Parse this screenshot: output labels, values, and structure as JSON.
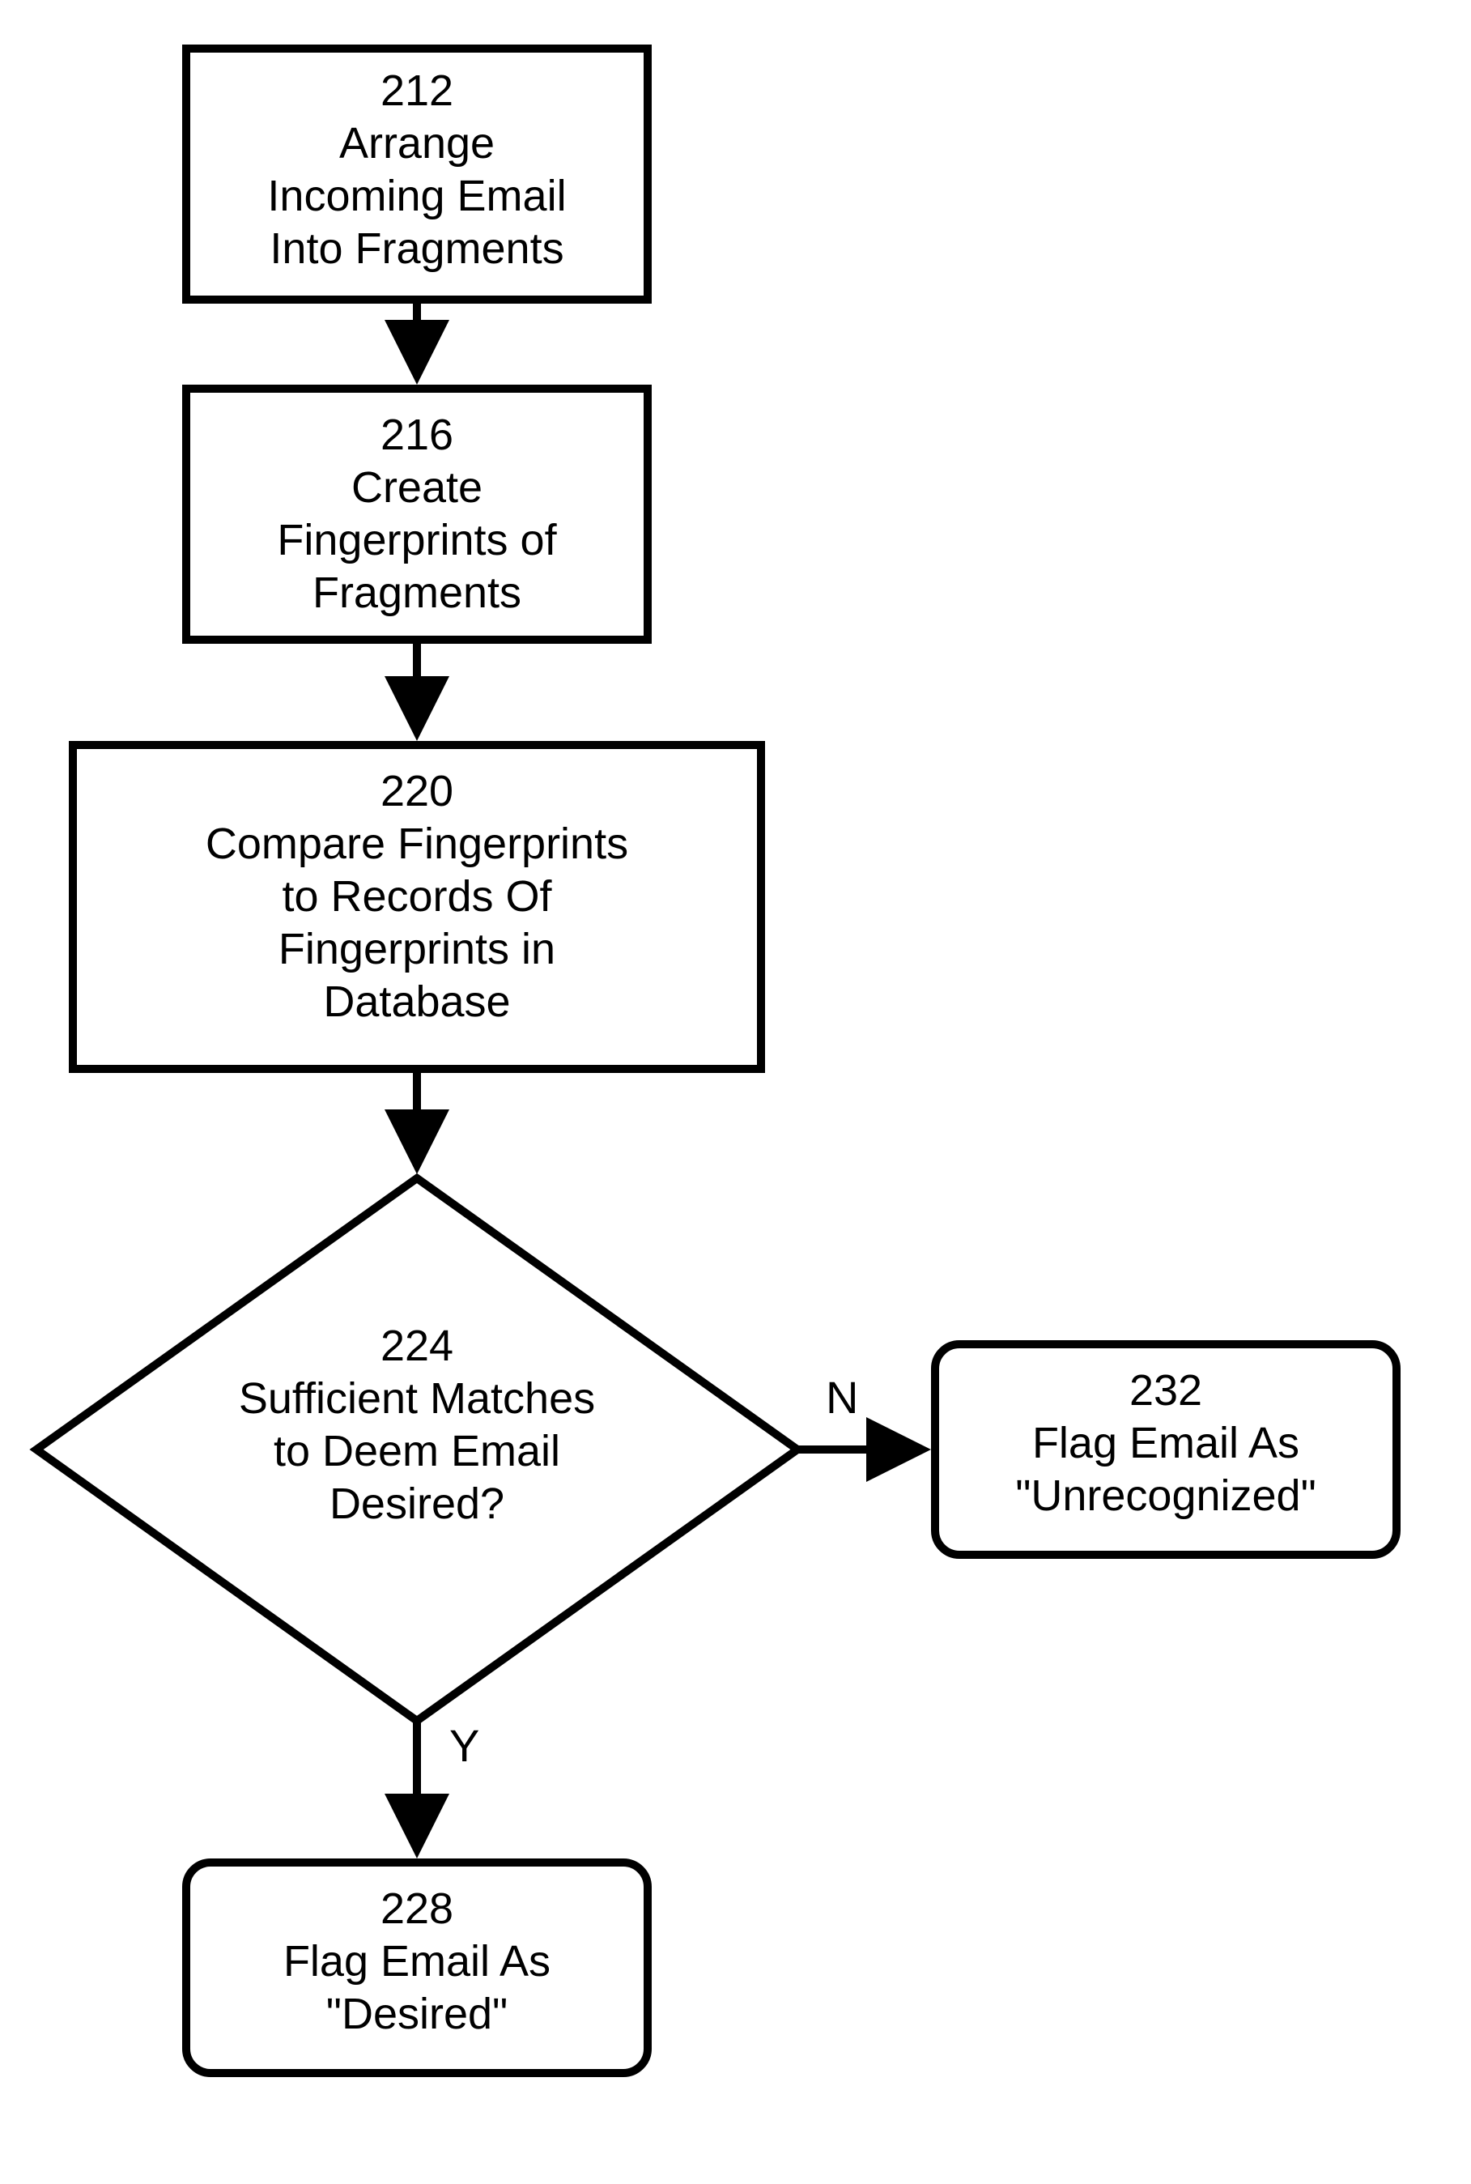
{
  "chart_data": {
    "type": "flowchart",
    "nodes": [
      {
        "id": "212",
        "kind": "process",
        "label": "Arrange Incoming Email Into Fragments"
      },
      {
        "id": "216",
        "kind": "process",
        "label": "Create Fingerprints of Fragments"
      },
      {
        "id": "220",
        "kind": "process",
        "label": "Compare Fingerprints to Records Of Fingerprints in Database"
      },
      {
        "id": "224",
        "kind": "decision",
        "label": "Sufficient Matches to Deem Email Desired?"
      },
      {
        "id": "228",
        "kind": "terminal",
        "label": "Flag Email As \"Desired\""
      },
      {
        "id": "232",
        "kind": "terminal",
        "label": "Flag Email As \"Unrecognized\""
      }
    ],
    "edges": [
      {
        "from": "212",
        "to": "216",
        "label": ""
      },
      {
        "from": "216",
        "to": "220",
        "label": ""
      },
      {
        "from": "220",
        "to": "224",
        "label": ""
      },
      {
        "from": "224",
        "to": "228",
        "label": "Y"
      },
      {
        "from": "224",
        "to": "232",
        "label": "N"
      }
    ]
  },
  "nodes": {
    "n212": {
      "num": "212",
      "l1": "Arrange",
      "l2": "Incoming Email",
      "l3": "Into Fragments"
    },
    "n216": {
      "num": "216",
      "l1": "Create",
      "l2": "Fingerprints of",
      "l3": "Fragments"
    },
    "n220": {
      "num": "220",
      "l1": "Compare Fingerprints",
      "l2": "to Records Of",
      "l3": "Fingerprints in",
      "l4": "Database"
    },
    "n224": {
      "num": "224",
      "l1": "Sufficient Matches",
      "l2": "to Deem Email",
      "l3": "Desired?"
    },
    "n228": {
      "num": "228",
      "l1": "Flag Email As",
      "l2": "\"Desired\""
    },
    "n232": {
      "num": "232",
      "l1": "Flag Email As",
      "l2": "\"Unrecognized\""
    }
  },
  "edge_labels": {
    "yes": "Y",
    "no": "N"
  }
}
